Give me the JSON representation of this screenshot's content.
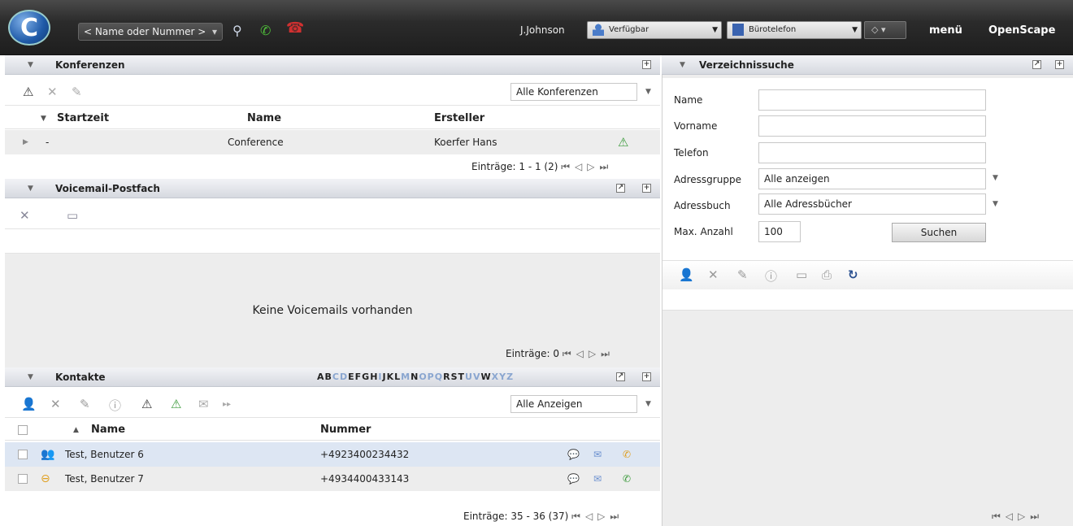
{
  "topbar": {
    "dial_placeholder": "< Name oder Nummer >",
    "user": "J.Johnson",
    "status": "Verfügbar",
    "device": "Bürotelefon",
    "menu": "menü",
    "brand": "OpenScape"
  },
  "conferences": {
    "title": "Konferenzen",
    "filter": "Alle Konferenzen",
    "columns": [
      "Startzeit",
      "Name",
      "Ersteller"
    ],
    "rows": [
      {
        "start": "-",
        "name": "Conference",
        "creator": "Koerfer Hans"
      }
    ],
    "entries_label": "Einträge: 1 - 1 (2)"
  },
  "voicemail": {
    "title": "Voicemail-Postfach",
    "empty": "Keine Voicemails vorhanden",
    "entries_label": "Einträge: 0"
  },
  "contacts": {
    "title": "Kontakte",
    "alphabet": [
      "A",
      "B",
      "C",
      "D",
      "E",
      "F",
      "G",
      "H",
      "I",
      "J",
      "K",
      "L",
      "M",
      "N",
      "O",
      "P",
      "Q",
      "R",
      "S",
      "T",
      "U",
      "V",
      "W",
      "X",
      "Y",
      "Z"
    ],
    "alphabet_active": [
      "A",
      "B",
      "E",
      "F",
      "G",
      "H",
      "J",
      "K",
      "L",
      "N",
      "R",
      "S",
      "T",
      "W"
    ],
    "filter": "Alle Anzeigen",
    "columns": [
      "Name",
      "Nummer"
    ],
    "rows": [
      {
        "name": "Test, Benutzer 6",
        "number": "+4923400234432"
      },
      {
        "name": "Test, Benutzer 7",
        "number": "+4934400433143"
      }
    ],
    "entries_label": "Einträge: 35 - 36 (37)"
  },
  "directory": {
    "title": "Verzeichnissuche",
    "fields": {
      "name_label": "Name",
      "firstname_label": "Vorname",
      "phone_label": "Telefon",
      "group_label": "Adressgruppe",
      "group_value": "Alle anzeigen",
      "book_label": "Adressbuch",
      "book_value": "Alle Adressbücher",
      "max_label": "Max. Anzahl",
      "max_value": "100"
    },
    "search_button": "Suchen"
  },
  "colors": {
    "accent": "#2a6fc0",
    "green": "#3a9a3a",
    "red": "#c0302a"
  }
}
